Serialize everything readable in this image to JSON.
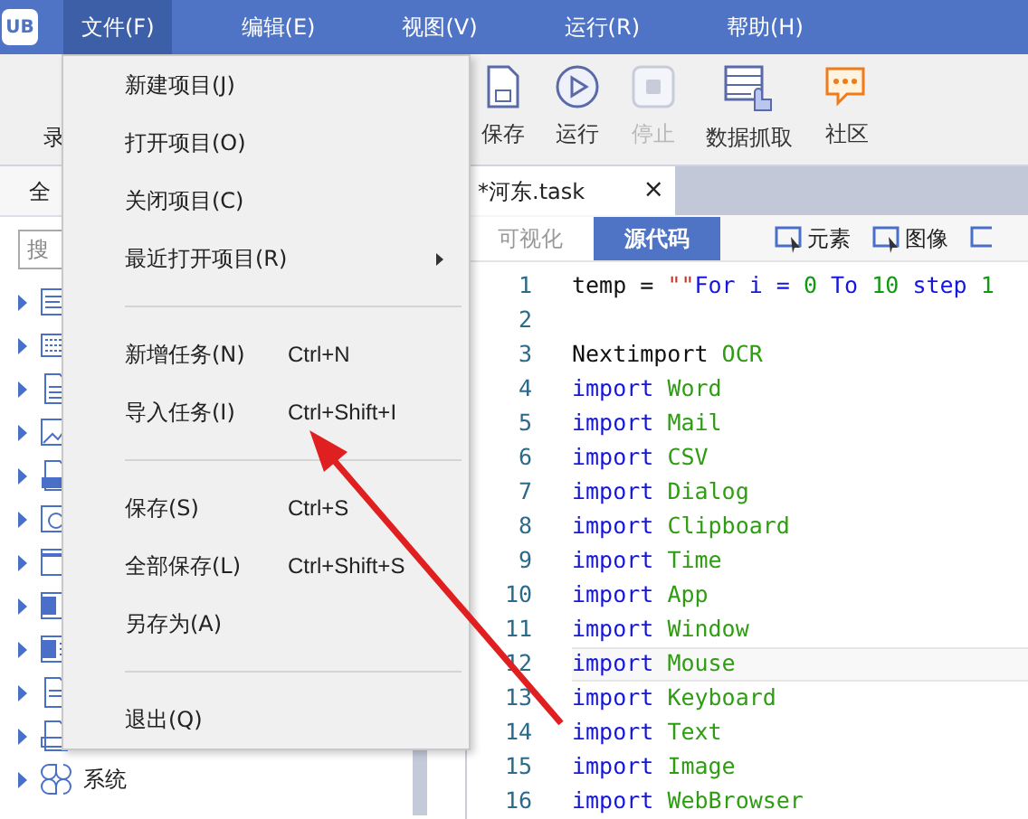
{
  "menubar": [
    {
      "label": "文件(F)",
      "selected": true
    },
    {
      "label": "编辑(E)",
      "selected": false
    },
    {
      "label": "视图(V)",
      "selected": false
    },
    {
      "label": "运行(R)",
      "selected": false
    },
    {
      "label": "帮助(H)",
      "selected": false
    }
  ],
  "app_badge": "UB",
  "toolbar_left": {
    "label": "录"
  },
  "toolbar": [
    {
      "label": "保存",
      "kind": "save",
      "disabled": false
    },
    {
      "label": "运行",
      "kind": "run",
      "disabled": false
    },
    {
      "label": "停止",
      "kind": "stop",
      "disabled": true
    },
    {
      "label": "数据抓取",
      "kind": "grab",
      "disabled": false
    },
    {
      "label": "社区",
      "kind": "community",
      "disabled": false
    }
  ],
  "left_panel": {
    "tab": "全",
    "search": {
      "placeholder": "搜"
    },
    "tree": [
      {
        "expanded": false
      },
      {
        "expanded": false
      },
      {
        "expanded": false
      },
      {
        "expanded": false
      },
      {
        "expanded": false
      },
      {
        "expanded": false
      },
      {
        "expanded": false
      },
      {
        "expanded": false
      },
      {
        "expanded": false
      },
      {
        "expanded": false
      },
      {
        "expanded": false
      },
      {
        "label": "系统",
        "expanded": false
      }
    ]
  },
  "file_menu": [
    {
      "kind": "item",
      "label": "新建项目(J)"
    },
    {
      "kind": "item",
      "label": "打开项目(O)"
    },
    {
      "kind": "item",
      "label": "关闭项目(C)"
    },
    {
      "kind": "item",
      "label": "最近打开项目(R)",
      "submenu": true
    },
    {
      "kind": "separator"
    },
    {
      "kind": "item",
      "label": "新增任务(N)",
      "shortcut": "Ctrl+N"
    },
    {
      "kind": "item",
      "label": "导入任务(I)",
      "shortcut": "Ctrl+Shift+I"
    },
    {
      "kind": "separator"
    },
    {
      "kind": "item",
      "label": "保存(S)",
      "shortcut": "Ctrl+S"
    },
    {
      "kind": "item",
      "label": "全部保存(L)",
      "shortcut": "Ctrl+Shift+S"
    },
    {
      "kind": "item",
      "label": "另存为(A)"
    },
    {
      "kind": "separator"
    },
    {
      "kind": "item",
      "label": "退出(Q)"
    }
  ],
  "editor": {
    "tab": {
      "title": "*河东.task",
      "close": "×"
    },
    "view_tabs": [
      {
        "label": "可视化",
        "selected": false
      },
      {
        "label": "源代码",
        "selected": true
      }
    ],
    "tools": [
      {
        "label": "元素",
        "kind": "element"
      },
      {
        "label": "图像",
        "kind": "image"
      },
      {
        "kind": "more"
      }
    ],
    "lines": [
      {
        "number": "1",
        "current": false,
        "tokens": [
          {
            "kind": "plain",
            "text": "temp = "
          },
          {
            "kind": "string",
            "text": "\"\""
          },
          {
            "kind": "keyword",
            "text": "For i = "
          },
          {
            "kind": "number",
            "text": "0"
          },
          {
            "kind": "keyword",
            "text": " To "
          },
          {
            "kind": "number",
            "text": "10"
          },
          {
            "kind": "keyword",
            "text": " step "
          },
          {
            "kind": "number",
            "text": "1"
          }
        ]
      },
      {
        "number": "2",
        "current": false
      },
      {
        "number": "3",
        "current": false,
        "tokens": [
          {
            "kind": "plain",
            "text": "Nextimport "
          },
          {
            "kind": "name",
            "text": "OCR"
          }
        ]
      },
      {
        "number": "4",
        "current": false,
        "tokens": [
          {
            "kind": "keyword",
            "text": "import "
          },
          {
            "kind": "name",
            "text": "Word"
          }
        ]
      },
      {
        "number": "5",
        "current": false,
        "tokens": [
          {
            "kind": "keyword",
            "text": "import "
          },
          {
            "kind": "name",
            "text": "Mail"
          }
        ]
      },
      {
        "number": "6",
        "current": false,
        "tokens": [
          {
            "kind": "keyword",
            "text": "import "
          },
          {
            "kind": "name",
            "text": "CSV"
          }
        ]
      },
      {
        "number": "7",
        "current": false,
        "tokens": [
          {
            "kind": "keyword",
            "text": "import "
          },
          {
            "kind": "name",
            "text": "Dialog"
          }
        ]
      },
      {
        "number": "8",
        "current": false,
        "tokens": [
          {
            "kind": "keyword",
            "text": "import "
          },
          {
            "kind": "name",
            "text": "Clipboard"
          }
        ]
      },
      {
        "number": "9",
        "current": false,
        "tokens": [
          {
            "kind": "keyword",
            "text": "import "
          },
          {
            "kind": "name",
            "text": "Time"
          }
        ]
      },
      {
        "number": "10",
        "current": false,
        "tokens": [
          {
            "kind": "keyword",
            "text": "import "
          },
          {
            "kind": "name",
            "text": "App"
          }
        ]
      },
      {
        "number": "11",
        "current": false,
        "tokens": [
          {
            "kind": "keyword",
            "text": "import "
          },
          {
            "kind": "name",
            "text": "Window"
          }
        ]
      },
      {
        "number": "12",
        "current": true,
        "tokens": [
          {
            "kind": "keyword",
            "text": "import "
          },
          {
            "kind": "name",
            "text": "Mouse"
          }
        ]
      },
      {
        "number": "13",
        "current": false,
        "tokens": [
          {
            "kind": "keyword",
            "text": "import "
          },
          {
            "kind": "name",
            "text": "Keyboard"
          }
        ]
      },
      {
        "number": "14",
        "current": false,
        "tokens": [
          {
            "kind": "keyword",
            "text": "import "
          },
          {
            "kind": "name",
            "text": "Text"
          }
        ]
      },
      {
        "number": "15",
        "current": false,
        "tokens": [
          {
            "kind": "keyword",
            "text": "import "
          },
          {
            "kind": "name",
            "text": "Image"
          }
        ]
      },
      {
        "number": "16",
        "current": false,
        "tokens": [
          {
            "kind": "keyword",
            "text": "import "
          },
          {
            "kind": "name",
            "text": "WebBrowser"
          }
        ]
      }
    ]
  }
}
